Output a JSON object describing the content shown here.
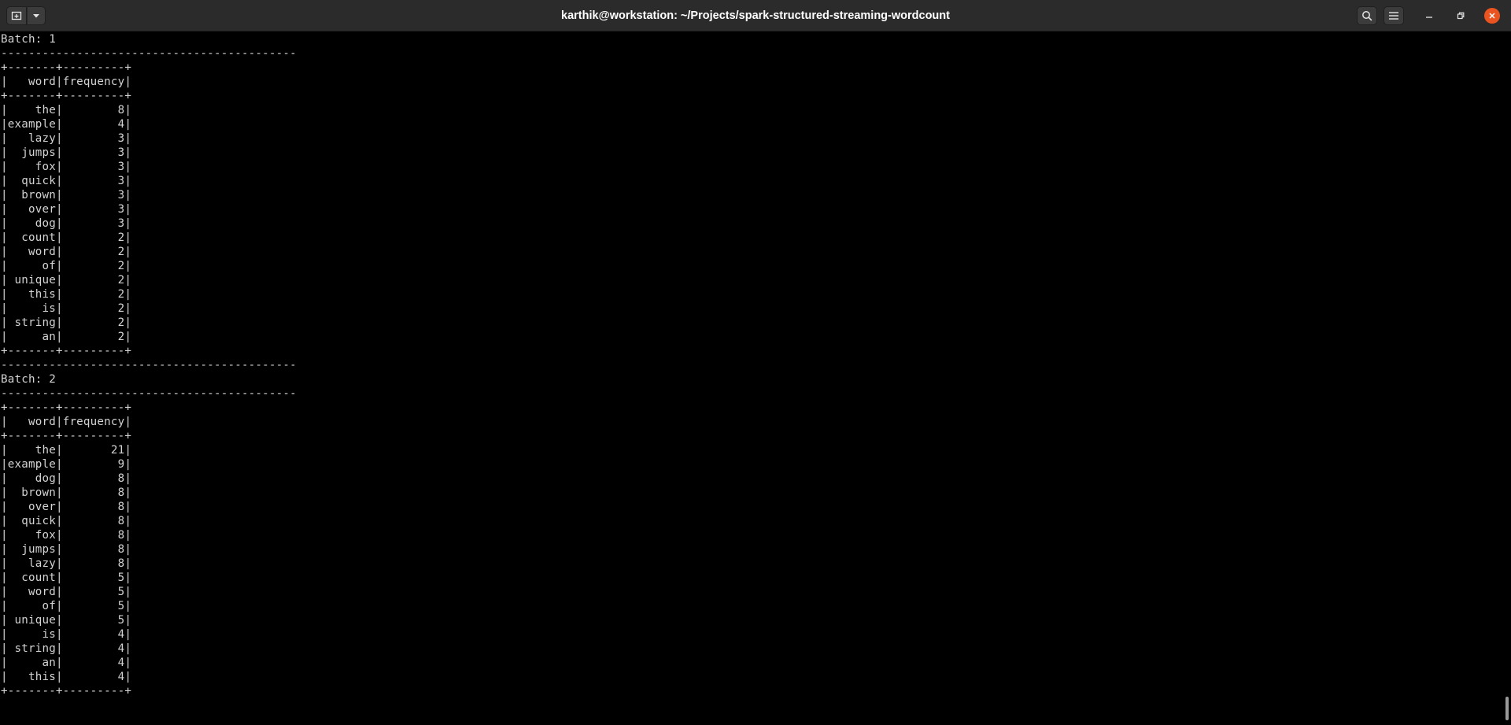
{
  "window": {
    "title": "karthik@workstation: ~/Projects/spark-structured-streaming-wordcount"
  },
  "titlebar": {
    "new_tab_icon": "new-tab-icon",
    "tab_menu_icon": "chevron-down-icon",
    "search_icon": "search-icon",
    "menu_icon": "hamburger-menu-icon",
    "minimize_icon": "minimize-icon",
    "maximize_icon": "restore-icon",
    "close_icon": "close-icon"
  },
  "colors": {
    "background": "#000000",
    "text": "#d3d3d3",
    "titlebar": "#2b2b2b",
    "close_button": "#e95420"
  },
  "batches": [
    {
      "label": "Batch: 1",
      "columns": [
        "word",
        "frequency"
      ],
      "rows": [
        [
          "the",
          "8"
        ],
        [
          "example",
          "4"
        ],
        [
          "lazy",
          "3"
        ],
        [
          "jumps",
          "3"
        ],
        [
          "fox",
          "3"
        ],
        [
          "quick",
          "3"
        ],
        [
          "brown",
          "3"
        ],
        [
          "over",
          "3"
        ],
        [
          "dog",
          "3"
        ],
        [
          "count",
          "2"
        ],
        [
          "word",
          "2"
        ],
        [
          "of",
          "2"
        ],
        [
          "unique",
          "2"
        ],
        [
          "this",
          "2"
        ],
        [
          "is",
          "2"
        ],
        [
          "string",
          "2"
        ],
        [
          "an",
          "2"
        ]
      ]
    },
    {
      "label": "Batch: 2",
      "columns": [
        "word",
        "frequency"
      ],
      "rows": [
        [
          "the",
          "21"
        ],
        [
          "example",
          "9"
        ],
        [
          "dog",
          "8"
        ],
        [
          "brown",
          "8"
        ],
        [
          "over",
          "8"
        ],
        [
          "quick",
          "8"
        ],
        [
          "fox",
          "8"
        ],
        [
          "jumps",
          "8"
        ],
        [
          "lazy",
          "8"
        ],
        [
          "count",
          "5"
        ],
        [
          "word",
          "5"
        ],
        [
          "of",
          "5"
        ],
        [
          "unique",
          "5"
        ],
        [
          "is",
          "4"
        ],
        [
          "string",
          "4"
        ],
        [
          "an",
          "4"
        ],
        [
          "this",
          "4"
        ]
      ]
    }
  ]
}
